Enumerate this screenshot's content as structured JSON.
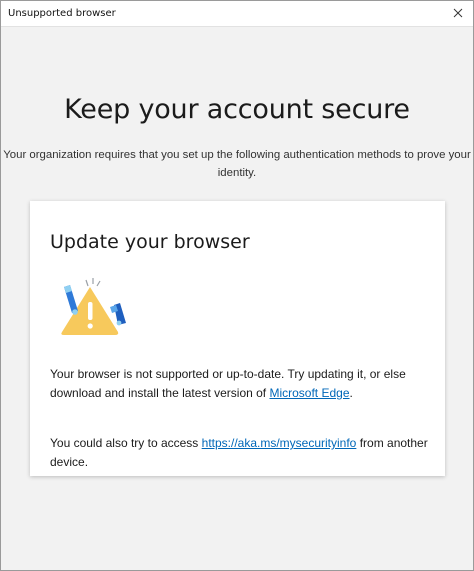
{
  "window": {
    "title": "Unsupported browser"
  },
  "header": {
    "heading": "Keep your account secure",
    "subtitle": "Your organization requires that you set up the following authentication methods to prove your identity."
  },
  "card": {
    "title": "Update your browser",
    "illustration_icon": "warning-browser-illustration",
    "message_prefix": "Your browser is not supported or up-to-date. Try updating it, or else download and install the latest version of ",
    "edge_link": "Microsoft Edge",
    "message_suffix": ".",
    "alt_prefix": "You could also try to access ",
    "security_link": "https://aka.ms/mysecurityinfo",
    "alt_suffix": " from another device."
  },
  "colors": {
    "link": "#0067b8",
    "warning": "#f7c95c",
    "accent_blue": "#1f5fbf"
  }
}
